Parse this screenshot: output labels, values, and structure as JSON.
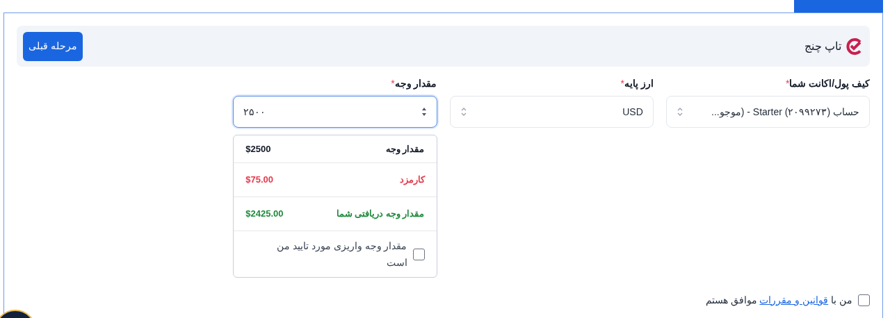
{
  "header": {
    "title": "تاپ چنج",
    "back_button": "مرحله قبلی"
  },
  "fields": [
    {
      "kind": "select",
      "label": "کیف پول/اکانت شما",
      "required_mark": "*",
      "value": "حساب (۲۰۹۹۲۷۳) Starter - (موجو...",
      "focused": false
    },
    {
      "kind": "select",
      "label": "ارز پایه",
      "required_mark": "*",
      "value": "USD",
      "focused": false
    },
    {
      "kind": "number",
      "label": "مقدار وجه",
      "required_mark": "*",
      "value": "۲۵۰۰",
      "focused": true
    }
  ],
  "summary": {
    "rows": [
      {
        "label": "مقدار وجه",
        "amount": "$2500",
        "color": "#111827"
      },
      {
        "label": "کارمزد",
        "amount": "$75.00",
        "color": "#e5394d"
      },
      {
        "label": "مقدار وجه دریافتی شما",
        "amount": "$2425.00",
        "color": "#1f8a3c"
      }
    ],
    "confirm": {
      "label": "مقدار وجه واریزی مورد تایید من است",
      "checked": false
    }
  },
  "terms": {
    "prefix": "من با",
    "link": "قوانین و مقررات",
    "suffix": "موافق هستم",
    "checked": false
  }
}
